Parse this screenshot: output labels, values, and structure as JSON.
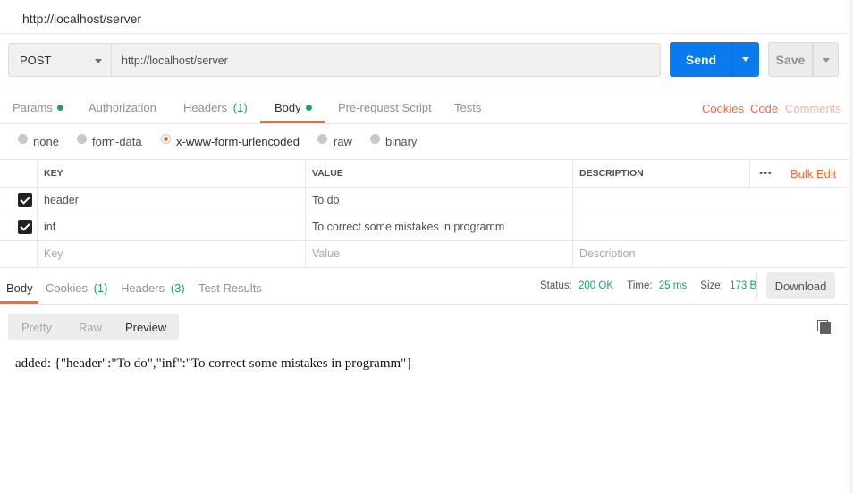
{
  "request_title": "http://localhost/server",
  "method": "POST",
  "url": "http://localhost/server",
  "send_label": "Send",
  "save_label": "Save",
  "req_tabs": {
    "params": "Params",
    "authorization": "Authorization",
    "headers": "Headers",
    "headers_count": "(1)",
    "body": "Body",
    "prerequest": "Pre-request Script",
    "tests": "Tests"
  },
  "right_links": {
    "cookies": "Cookies",
    "code": "Code",
    "comments": "Comments"
  },
  "body_types": {
    "none": "none",
    "form_data": "form-data",
    "urlencoded": "x-www-form-urlencoded",
    "raw": "raw",
    "binary": "binary",
    "selected": "x-www-form-urlencoded"
  },
  "table": {
    "headers": {
      "key": "KEY",
      "value": "VALUE",
      "description": "DESCRIPTION"
    },
    "more": "•••",
    "bulk_edit": "Bulk Edit",
    "rows": [
      {
        "checked": true,
        "key": "header",
        "value": "To do",
        "description": ""
      },
      {
        "checked": true,
        "key": "inf",
        "value": "To correct some mistakes in programm",
        "description": ""
      }
    ],
    "placeholder": {
      "key": "Key",
      "value": "Value",
      "description": "Description"
    }
  },
  "resp_tabs": {
    "body": "Body",
    "cookies": "Cookies",
    "cookies_count": "(1)",
    "headers": "Headers",
    "headers_count": "(3)",
    "test_results": "Test Results"
  },
  "status": {
    "status_label": "Status:",
    "status_value": "200 OK",
    "time_label": "Time:",
    "time_value": "25 ms",
    "size_label": "Size:",
    "size_value": "173 B"
  },
  "download_label": "Download",
  "view_modes": {
    "pretty": "Pretty",
    "raw": "Raw",
    "preview": "Preview",
    "selected": "Preview"
  },
  "response_text": "added: {\"header\":\"To do\",\"inf\":\"To correct some mistakes in programm\"}",
  "colors": {
    "accent": "#f26b3a",
    "send": "#097bed",
    "ok": "#1c9e78"
  }
}
